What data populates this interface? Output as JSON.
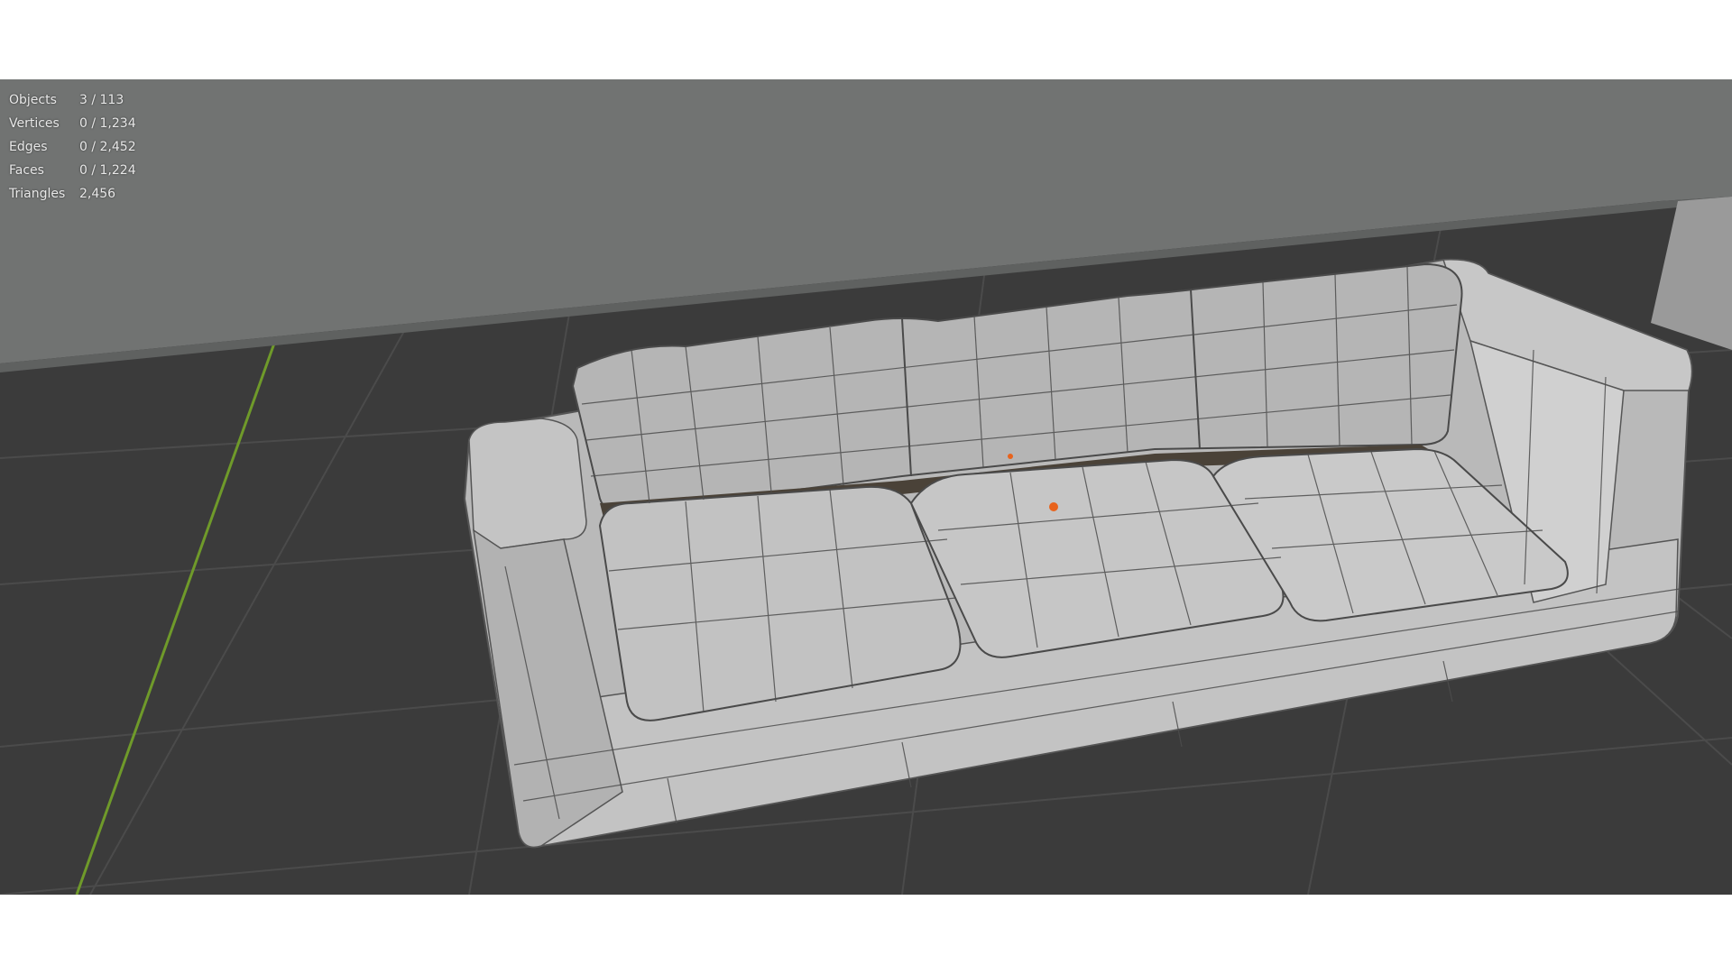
{
  "viewport": {
    "stats": [
      {
        "label": "Objects",
        "value": "3 / 113"
      },
      {
        "label": "Vertices",
        "value": "0 / 1,234"
      },
      {
        "label": "Edges",
        "value": "0 / 2,452"
      },
      {
        "label": "Faces",
        "value": "0 / 1,224"
      },
      {
        "label": "Triangles",
        "value": "2,456"
      }
    ],
    "colors": {
      "floor": "#3b3b3b",
      "grid_line": "#4c4c4c",
      "y_axis": "#6f9a2a",
      "wall": "#6f7170",
      "mesh": "#bcbcbc",
      "mesh_shadow": "#8a8a8a",
      "wire": "#3a3a3a",
      "origin": "#e8631c"
    }
  }
}
